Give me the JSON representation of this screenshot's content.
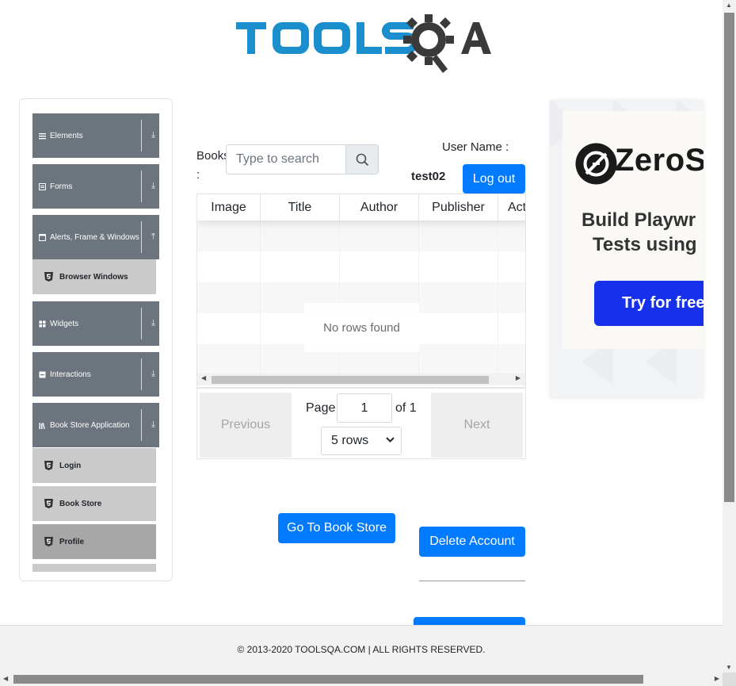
{
  "header": {
    "logo_text": "TOOLSQA"
  },
  "sidebar": {
    "groups": [
      {
        "label": "Elements",
        "icon": "list-icon",
        "expanded": false
      },
      {
        "label": "Forms",
        "icon": "form-icon",
        "expanded": false
      },
      {
        "label": "Alerts, Frame & Windows",
        "icon": "window-icon",
        "expanded": true,
        "items": [
          "Browser Windows"
        ]
      },
      {
        "label": "Widgets",
        "icon": "grid-icon",
        "expanded": false
      },
      {
        "label": "Interactions",
        "icon": "interaction-icon",
        "expanded": false
      },
      {
        "label": "Book Store Application",
        "icon": "books-icon",
        "expanded": true,
        "items": [
          "Login",
          "Book Store",
          "Profile"
        ],
        "active": "Profile"
      }
    ]
  },
  "main": {
    "search_label": "Books :",
    "search_placeholder": "Type to search",
    "user_label": "User Name :",
    "user_value": "test02",
    "logout_label": "Log out",
    "table": {
      "columns": [
        "Image",
        "Title",
        "Author",
        "Publisher",
        "Actions"
      ],
      "empty_text": "No rows found"
    },
    "pagination": {
      "previous_label": "Previous",
      "next_label": "Next",
      "page_label": "Page",
      "page_value": "1",
      "of_label": "of 1",
      "rows_option": "5 rows"
    },
    "goto_store_label": "Go To Book Store",
    "delete_account_label": "Delete Account"
  },
  "ad": {
    "brand": "ZeroS",
    "headline_line1": "Build Playwr",
    "headline_line2": "Tests using",
    "cta": "Try for free"
  },
  "footer": {
    "text": "© 2013-2020 TOOLSQA.COM | ALL RIGHTS RESERVED."
  },
  "colors": {
    "primary": "#007bff",
    "sidebar_group": "#6c757d",
    "logo_blue": "#1b8fcd",
    "ad_cta": "#1730ec"
  }
}
